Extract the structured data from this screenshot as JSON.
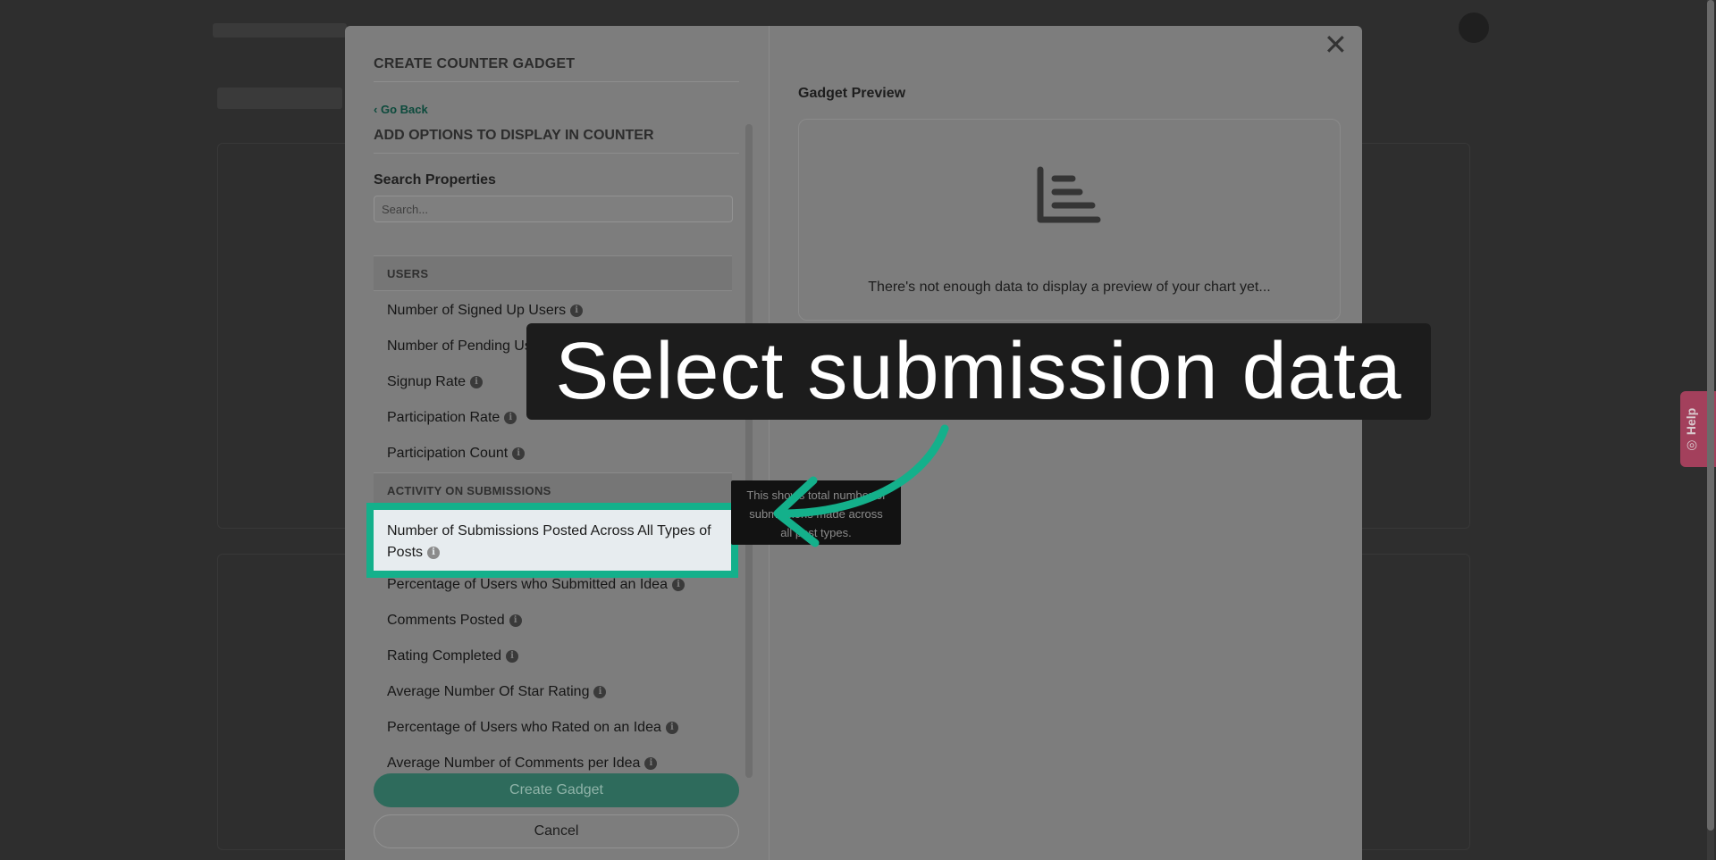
{
  "modal": {
    "title": "CREATE COUNTER GADGET",
    "go_back": "Go Back",
    "section_title": "ADD OPTIONS TO DISPLAY IN COUNTER",
    "search_label": "Search Properties",
    "search_placeholder": "Search...",
    "groups": [
      {
        "header": "USERS",
        "items": [
          "Number of Signed Up Users",
          "Number of Pending Users",
          "Signup Rate",
          "Participation Rate",
          "Participation Count"
        ]
      },
      {
        "header": "ACTIVITY ON SUBMISSIONS",
        "items": [
          "Number of Submissions Posted Across All Types of Posts",
          "Percentage of Users who Submitted an Idea",
          "Comments Posted",
          "Rating Completed",
          "Average Number Of Star Rating",
          "Percentage of Users who Rated on an Idea",
          "Average Number of Comments per Idea"
        ]
      }
    ],
    "create_button": "Create Gadget",
    "cancel_button": "Cancel",
    "close_icon": "close-icon"
  },
  "preview": {
    "title": "Gadget Preview",
    "icon": "bar-chart-icon",
    "message": "There's not enough data to display a preview of your chart yet..."
  },
  "tooltip": {
    "line1": "This shows total number of",
    "line2": "submissions made across",
    "line3": "all post types."
  },
  "callout": {
    "text": "Select submission data"
  },
  "help": {
    "label": "Help"
  },
  "colors": {
    "accent": "#14b08b",
    "help_tab": "#a3405c",
    "overlay": "#2b2b2b"
  }
}
